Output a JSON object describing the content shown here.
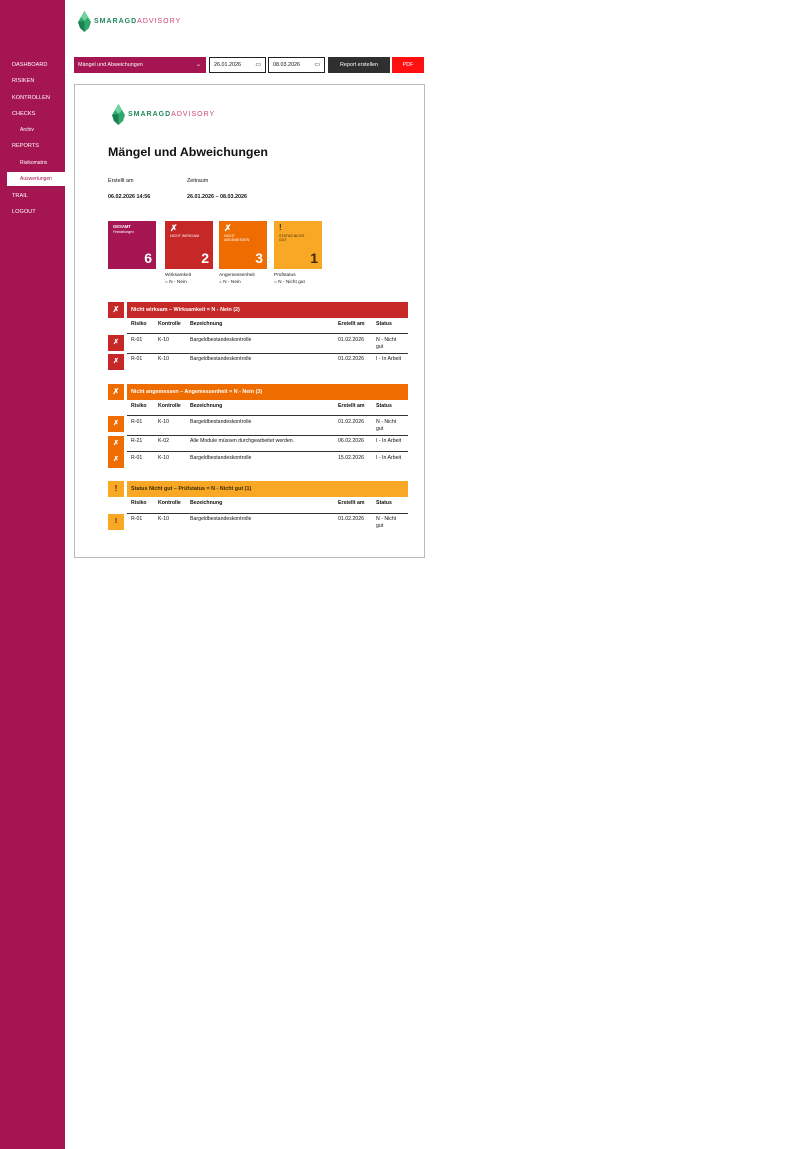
{
  "brand": {
    "name_a": "SMARAGD",
    "name_b": "ADVISORY"
  },
  "sidebar": {
    "items": [
      {
        "label": "DASHBOARD"
      },
      {
        "label": "RISIKEN"
      },
      {
        "label": "KONTROLLEN"
      },
      {
        "label": "CHECKS"
      },
      {
        "label": "Archiv"
      },
      {
        "label": "REPORTS"
      },
      {
        "label": "Risikomatrix"
      },
      {
        "label": "Auswertungen"
      },
      {
        "label": "TRAIL"
      },
      {
        "label": "LOGOUT"
      }
    ]
  },
  "toolbar": {
    "report_type": "Mängel und Abweichungen",
    "date_from": "26.01.2026",
    "date_to": "08.03.2026",
    "create_label": "Report erstellen",
    "pdf_label": "PDF"
  },
  "report": {
    "title": "Mängel und Abweichungen",
    "created_label": "Erstellt am",
    "created_value": "06.02.2026 14:56",
    "period_label": "Zeitraum",
    "period_value": "26.01.2026 – 08.03.2026",
    "kpis": {
      "total_title": "GESAMT",
      "total_sub": "Feststellungen",
      "total_value": "6",
      "ineffective_label": "NICHT WIRKSAM",
      "ineffective_value": "2",
      "ineffective_caption1": "Wirksamkeit",
      "ineffective_caption2": "= N - Nein",
      "inadequate_label": "NICHT ANGEMESSEN",
      "inadequate_value": "3",
      "inadequate_caption1": "Angemessenheit",
      "inadequate_caption2": "= N - Nein",
      "status_label": "STATUS NICHT GUT",
      "status_value": "1",
      "status_caption1": "Prüfstatus",
      "status_caption2": "= N - Nicht gut"
    },
    "columns": {
      "risk": "Risiko",
      "control": "Kontrolle",
      "name": "Bezeichnung",
      "created": "Erstellt am",
      "status": "Status"
    },
    "sections": [
      {
        "title": "Nicht wirksam – Wirksamkeit = N - Nein (2)",
        "rows": [
          {
            "risk": "R-01",
            "control": "K-10",
            "name": "Bargeldbestandeskontrolle",
            "created": "01.02.2026",
            "status1": "N - Nicht",
            "status2": "gut"
          },
          {
            "risk": "R-01",
            "control": "K-10",
            "name": "Bargeldbestandeskontrolle",
            "created": "01.02.2026",
            "status1": "I - In Arbeit",
            "status2": ""
          }
        ]
      },
      {
        "title": "Nicht angemessen – Angemessenheit = N - Nein (3)",
        "rows": [
          {
            "risk": "R-01",
            "control": "K-10",
            "name": "Bargeldbestandeskontrolle",
            "created": "01.02.2026",
            "status1": "N - Nicht",
            "status2": "gut"
          },
          {
            "risk": "R-21",
            "control": "K-02",
            "name": "Alle Module müssen durchgearbeitet werden.",
            "created": "06.02.2026",
            "status1": "I - In Arbeit",
            "status2": ""
          },
          {
            "risk": "R-01",
            "control": "K-10",
            "name": "Bargeldbestandeskontrolle",
            "created": "15.02.2026",
            "status1": "I - In Arbeit",
            "status2": ""
          }
        ]
      },
      {
        "title": "Status Nicht gut – Prüfstatus = N - Nicht gut (1)",
        "rows": [
          {
            "risk": "R-01",
            "control": "K-10",
            "name": "Bargeldbestandeskontrolle",
            "created": "01.02.2026",
            "status1": "N - Nicht",
            "status2": "gut"
          }
        ]
      }
    ]
  },
  "colors": {
    "sidebar": "#a51551",
    "red": "#c62828",
    "orange": "#ef6c00",
    "amber": "#f9a825",
    "pdf": "#ff1010",
    "dark": "#2f2f2f"
  },
  "icons": {
    "cross": "✗",
    "warn": "!",
    "chevron": "⌄",
    "calendar": "▭"
  }
}
